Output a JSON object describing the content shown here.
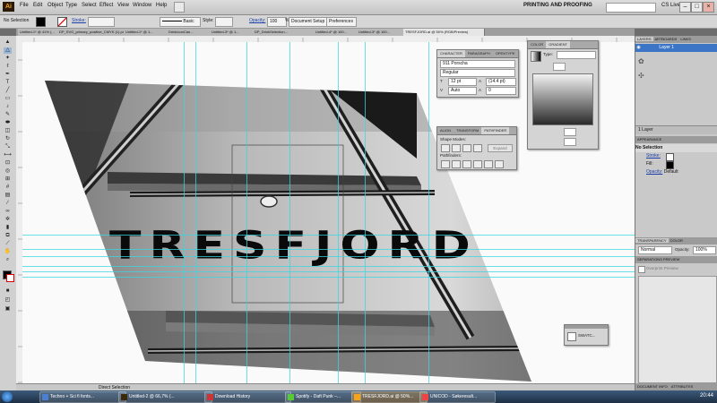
{
  "app": {
    "logo": "Ai",
    "workspace": "PRINTING AND PROOFING",
    "cs_live": "CS Live",
    "window_controls": [
      "–",
      "□",
      "×"
    ]
  },
  "menu": [
    "File",
    "Edit",
    "Object",
    "Type",
    "Select",
    "Effect",
    "View",
    "Window",
    "Help"
  ],
  "control_bar": {
    "selection": "No Selection",
    "fill_color": "#000000",
    "stroke_label": "Stroke:",
    "stroke_value": "",
    "brush": "Basic",
    "style_label": "Style:",
    "opacity_label": "Opacity:",
    "opacity_value": "100",
    "opacity_unit": "%",
    "document_setup": "Document Setup",
    "preferences": "Preferences"
  },
  "tabs": [
    "Untitled-1* @ 41% (...",
    "DP_SVG_primary_positive_CMYK (1).pdf*",
    "Untitled-1* @ 1...",
    "DrinkIconCan...",
    "Untitled-3* @ 1...",
    "DP_DrinkSelection...",
    "Untitled-4* @ 100...",
    "Untitled-3* @ 100...",
    "TRESFJORD.ai @ 50% (RGB/Preview)"
  ],
  "canvas": {
    "headline": "TRESFJORD",
    "status": "Direct Selection"
  },
  "character_panel": {
    "tabs": [
      "CHARACTER",
      "PARAGRAPH",
      "OPENTYPE"
    ],
    "font_family": "911 Porscha",
    "font_style": "Regular",
    "font_size": "12 pt",
    "leading": "(14.4 pt)",
    "kerning": "Auto",
    "tracking": "0"
  },
  "pathfinder_panel": {
    "tabs": [
      "ALIGN",
      "TRANSFORM",
      "PATHFINDER"
    ],
    "shape_modes_label": "Shape Modes:",
    "expand_label": "Expand",
    "pathfinders_label": "Pathfinders:"
  },
  "gradient_panel": {
    "tabs": [
      "COLOR",
      "GRADIENT"
    ],
    "type_label": "Type:"
  },
  "swatch_panel": {
    "label": "SWATC..."
  },
  "layers_panel": {
    "tabs": [
      "LAYERS",
      "ARTBOARDS",
      "LINKS"
    ],
    "layer_name": "Layer 1",
    "count_label": "1 Layer"
  },
  "appearance_panel": {
    "tab": "APPEARANCE",
    "selection": "No Selection",
    "stroke_label": "Stroke:",
    "fill_label": "Fill:",
    "opacity_label": "Opacity:",
    "opacity_value": "Default"
  },
  "transparency_panel": {
    "tabs": [
      "TRANSPARENCY",
      "COLOR"
    ],
    "mode": "Normal",
    "opacity_label": "Opacity:",
    "opacity_value": "100%"
  },
  "separations_panel": {
    "tab": "SEPARATIONS PREVIEW",
    "overprint_label": "Overprint Preview"
  },
  "doc_info_panel": {
    "tabs": [
      "DOCUMENT INFO",
      "ATTRIBUTES"
    ]
  },
  "taskbar": {
    "items": [
      "Techno + Sci fi fonts...",
      "Untitled-2 @ 66,7% (...",
      "Download History",
      "Spotify - Daft Punk –...",
      "TRESFJORD.ai @ 50%...",
      "UNICOD - Søkeresult..."
    ],
    "clock": "20:44"
  }
}
